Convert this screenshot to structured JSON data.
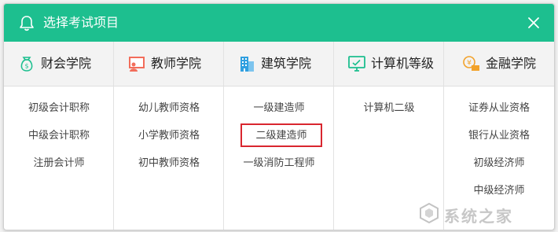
{
  "dialog": {
    "title": "选择考试项目",
    "header_color": "#1dbf8f"
  },
  "tabs": [
    {
      "label": "财会学院",
      "icon": "money-bag-icon",
      "color": "#1dbf8f"
    },
    {
      "label": "教师学院",
      "icon": "teacher-board-icon",
      "color": "#f26d5b"
    },
    {
      "label": "建筑学院",
      "icon": "building-icon",
      "color": "#2f9fe0"
    },
    {
      "label": "计算机等级",
      "icon": "monitor-icon",
      "color": "#1dbf8f"
    },
    {
      "label": "金融学院",
      "icon": "coin-card-icon",
      "color": "#f2a22a"
    }
  ],
  "columns": [
    {
      "items": [
        "初级会计职称",
        "中级会计职称",
        "注册会计师"
      ]
    },
    {
      "items": [
        "幼儿教师资格",
        "小学教师资格",
        "初中教师资格"
      ]
    },
    {
      "items": [
        "一级建造师",
        "二级建造师",
        "一级消防工程师"
      ]
    },
    {
      "items": [
        "计算机二级"
      ]
    },
    {
      "items": [
        "证券从业资格",
        "银行从业资格",
        "初级经济师",
        "中级经济师"
      ]
    }
  ],
  "highlighted_item": "二级建造师",
  "highlight_color": "#d9262f",
  "watermark": {
    "text": "系统之家"
  }
}
